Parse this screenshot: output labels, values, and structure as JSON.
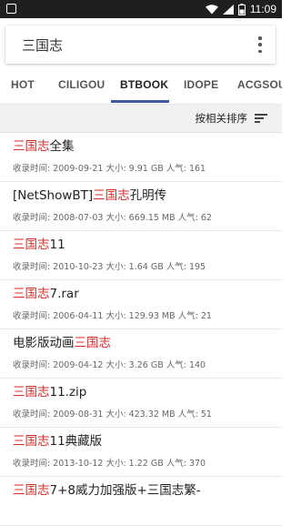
{
  "status_bar": {
    "time": "11:09",
    "battery_level": "half"
  },
  "search": {
    "query": "三国志"
  },
  "tabs": [
    {
      "label": "HOT"
    },
    {
      "label": "CILIGOU"
    },
    {
      "label": "BTBOOK"
    },
    {
      "label": "IDOPE"
    },
    {
      "label": "ACGSOU"
    }
  ],
  "active_tab": "BTBOOK",
  "sort": {
    "label": "按相关排序"
  },
  "results": [
    {
      "title_pre": "",
      "title_hl": "三国志",
      "title_post": "全集",
      "meta": "收录时间: 2009-09-21 大小: 9.91 GB 人气: 161"
    },
    {
      "title_pre": "[NetShowBT]",
      "title_hl": "三国志",
      "title_post": "孔明传",
      "meta": "收录时间: 2008-07-03 大小: 669.15 MB 人气: 62"
    },
    {
      "title_pre": "",
      "title_hl": "三国志",
      "title_post": "11",
      "meta": "收录时间: 2010-10-23 大小: 1.64 GB 人气: 195"
    },
    {
      "title_pre": "",
      "title_hl": "三国志",
      "title_post": "7.rar",
      "meta": "收录时间: 2006-04-11 大小: 129.93 MB 人气: 21"
    },
    {
      "title_pre": "电影版动画",
      "title_hl": "三国志",
      "title_post": "",
      "meta": "收录时间: 2009-04-12 大小: 3.26 GB 人气: 140"
    },
    {
      "title_pre": "",
      "title_hl": "三国志",
      "title_post": "11.zip",
      "meta": "收录时间: 2009-08-31 大小: 423.32 MB 人气: 51"
    },
    {
      "title_pre": "",
      "title_hl": "三国志",
      "title_post": "11典藏版",
      "meta": "收录时间: 2013-10-12 大小: 1.22 GB 人气: 370"
    },
    {
      "title_pre": "",
      "title_hl": "三国志",
      "title_post": "7+8威力加强版+三国志繁-",
      "meta": ""
    }
  ],
  "colors": {
    "highlight": "#d92a2a",
    "tab_indicator": "#3f5a9a",
    "status_bar": "#1f1f1f"
  }
}
